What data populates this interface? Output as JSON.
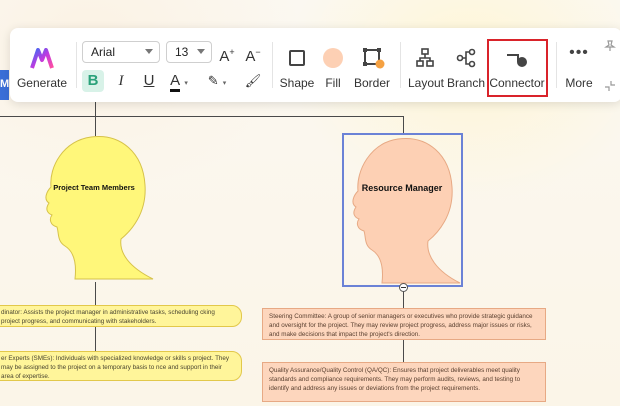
{
  "toolbar": {
    "generate_label": "Generate",
    "font_family": "Arial",
    "font_size": "13",
    "increase_font": "A",
    "decrease_font": "A",
    "bold": "B",
    "italic": "I",
    "underline": "U",
    "font_color": "A",
    "shape_label": "Shape",
    "fill_label": "Fill",
    "border_label": "Border",
    "layout_label": "Layout",
    "branch_label": "Branch",
    "connector_label": "Connector",
    "more_label": "More"
  },
  "left_tab_letter": "M",
  "nodes": {
    "project_team_members": "Project Team Members",
    "resource_manager": "Resource Manager"
  },
  "left_items": [
    "dinator: Assists the project manager in administrative tasks, scheduling cking project progress, and communicating with stakeholders.",
    "er Experts (SMEs): Individuals with specialized knowledge or skills s project. They may be assigned to the project on a temporary basis to nce and support in their area of expertise."
  ],
  "right_items": [
    "Steering Committee: A group of senior managers or executives who provide strategic guidance and oversight for the project. They may review project progress, address major issues or risks, and make decisions that impact the project's direction.",
    "Quality Assurance/Quality Control (QA/QC): Ensures that project deliverables meet quality standards and compliance requirements. They may perform audits, reviews, and testing to identify and address any issues or deviations from the project requirements."
  ],
  "colors": {
    "yellow_head": "#fff77a",
    "peach_head": "#fdd0b4",
    "selection": "#6b82d6",
    "highlight": "#d9232a",
    "brand_left_tab": "#3b6fd8"
  }
}
